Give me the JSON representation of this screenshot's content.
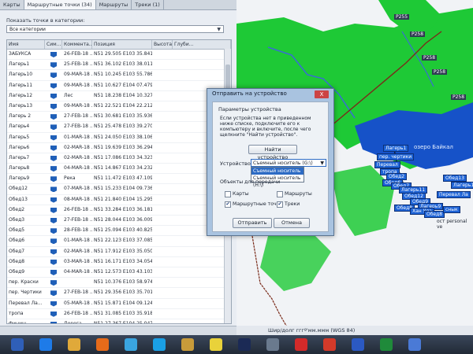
{
  "tabs": [
    "Карты",
    "Маршрутные точки (34)",
    "Маршруты",
    "Треки (1)"
  ],
  "filter": {
    "label": "Показать точки в категории:",
    "value": "Все категории"
  },
  "table": {
    "columns": [
      "Имя",
      "Сим...",
      "Коммента...",
      "Позиция",
      "Высота",
      "Глуби..."
    ],
    "rows": [
      {
        "name": "ЗАБУКСА",
        "comment": "26-FEB-18 ...",
        "pos": "N51 29.505 E103 35.841"
      },
      {
        "name": "Лагерь1",
        "comment": "25-FEB-18 ...",
        "pos": "N51 36.102 E103 38.011"
      },
      {
        "name": "Лагерь10",
        "comment": "09-MAR-18 ...",
        "pos": "N51 10.245 E103 55.786"
      },
      {
        "name": "Лагерь11",
        "comment": "09-MAR-18 ...",
        "pos": "N51 10.627 E104 07.479"
      },
      {
        "name": "Лагерь12",
        "comment": "Лес",
        "pos": "N51 18.238 E104 10.327"
      },
      {
        "name": "Лагерь13",
        "comment": "09-MAR-18 ...",
        "pos": "N51 22.521 E104 22.212"
      },
      {
        "name": "Лагерь 2",
        "comment": "27-FEB-18 ...",
        "pos": "N51 30.681 E103 35.936"
      },
      {
        "name": "Лагерь4",
        "comment": "27-FEB-18 ...",
        "pos": "N51 25.478 E103 39.270"
      },
      {
        "name": "Лагерь5",
        "comment": "01-MAR-18 ...",
        "pos": "N51 24.050 E103 38.106"
      },
      {
        "name": "Лагерь6",
        "comment": "02-MAR-18 ...",
        "pos": "N51 19.639 E103 36.294"
      },
      {
        "name": "Лагерь7",
        "comment": "02-MAR-18 ...",
        "pos": "N51 17.086 E103 34.323"
      },
      {
        "name": "Лагерь8",
        "comment": "04-MAR-18 ...",
        "pos": "N51 14.867 E103 34.232"
      },
      {
        "name": "Лагерь9",
        "comment": "Река",
        "pos": "N51 11.472 E103 47.109"
      },
      {
        "name": "Обед12",
        "comment": "07-MAR-18 ...",
        "pos": "N51 15.233 E104 09.736"
      },
      {
        "name": "Обед13",
        "comment": "08-MAR-18 ...",
        "pos": "N51 21.840 E104 15.295"
      },
      {
        "name": "Обед2",
        "comment": "26-FEB-18 ...",
        "pos": "N51 33.284 E103 36.181"
      },
      {
        "name": "Обед3",
        "comment": "27-FEB-18 ...",
        "pos": "N51 28.044 E103 36.009"
      },
      {
        "name": "Обед5",
        "comment": "28-FEB-18 ...",
        "pos": "N51 25.094 E103 40.825"
      },
      {
        "name": "Обед6",
        "comment": "01-MAR-18 ...",
        "pos": "N51 22.123 E103 37.085"
      },
      {
        "name": "Обед7",
        "comment": "02-MAR-18 ...",
        "pos": "N51 17.912 E103 35.050"
      },
      {
        "name": "Обед8",
        "comment": "03-MAR-18 ...",
        "pos": "N51 16.171 E103 34.054"
      },
      {
        "name": "Обед9",
        "comment": "04-MAR-18 ...",
        "pos": "N51 12.573 E103 43.103"
      },
      {
        "name": "пер. Краски",
        "comment": "",
        "pos": "N51 10.376 E103 58.974"
      },
      {
        "name": "пер. Чертики",
        "comment": "27-FEB-18 ...",
        "pos": "N51 29.356 E103 35.701"
      },
      {
        "name": "Перевал Ла...",
        "comment": "05-MAR-18 ...",
        "pos": "N51 15.871 E104 09.124"
      },
      {
        "name": "тропа",
        "comment": "26-FEB-18 ...",
        "pos": "N51 31.085 E103 35.918"
      },
      {
        "name": "Финиш",
        "comment": "Дорога",
        "pos": "N51 27.367 E104 25.047"
      },
      {
        "name": "Хан Ула",
        "comment": "06-MAR-18 ...",
        "pos": "N51 10.941 E103 58.838"
      }
    ]
  },
  "statusbar": {
    "coords": "Шир/долг гггº'мм.ммм (WGS 84)"
  },
  "map": {
    "labels": {
      "lake": "озеро Байкал",
      "road1": "P255",
      "road2": "P258",
      "road3": "P258",
      "road4": "P258",
      "road5": "P258",
      "personal": "ост personal ve"
    },
    "waypoints": [
      "Лагерь1",
      "пер. чертики",
      "Перевал",
      "тропа",
      "Обед2",
      "Обед6",
      "Обед7",
      "Лагерь11",
      "Обед12",
      "Обед13",
      "Лагерь13",
      "Перевал Ла",
      "Обед9",
      "Лагерь9",
      "Обед8",
      "Хан Ула",
      "Обед8",
      "снык"
    ]
  },
  "dialog": {
    "title": "Отправить на устройство",
    "close": "X",
    "group_title": "Параметры устройства",
    "text": "Если устройства нет в приведенном ниже списке, подключите его к компьютеру и включите, после чего щелкните \"Найти устройство\".",
    "find_button": "Найти устройство",
    "device_label": "Устройство:",
    "device_value": "Съемный носитель (G:\\)",
    "dropdown": [
      "Съемный носитель (G:\\)",
      "Съемный носитель (H:\\)"
    ],
    "objects_label": "Объекты для передачи",
    "options": [
      {
        "label": "Карты",
        "checked": false
      },
      {
        "label": "Маршруты",
        "checked": false
      },
      {
        "label": "Маршрутные точки",
        "checked": true
      },
      {
        "label": "Треки",
        "checked": true
      }
    ],
    "ok_button": "Отправить",
    "cancel_button": "Отмена"
  },
  "taskbar": {
    "icons": [
      "start-orb",
      "internet-explorer-icon",
      "file-explorer-icon",
      "media-player-icon",
      "chrome-icon",
      "skype-icon",
      "folder-icon",
      "sticky-notes-icon",
      "photoshop-icon",
      "tool-icon",
      "adobe-icon",
      "foxit-icon",
      "word-icon",
      "gps-icon",
      "basecamp-icon"
    ]
  },
  "colors": {
    "map_green": "#1ec936",
    "map_dark_green": "#0e8a22",
    "water": "#1652c8",
    "river": "#3a6bd6",
    "road": "#7a2b1a",
    "waypoint_label_bg": "#1e63d6"
  }
}
